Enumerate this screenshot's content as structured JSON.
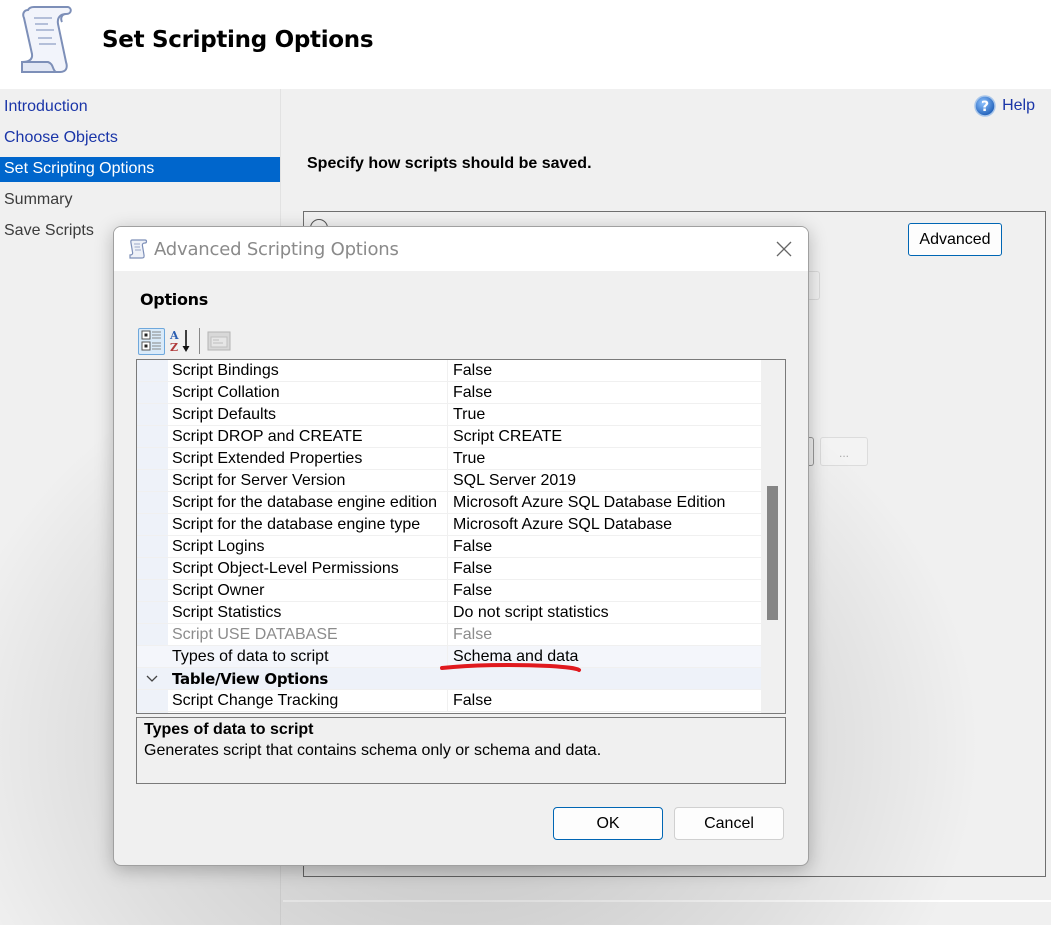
{
  "header": {
    "title": "Set Scripting Options",
    "icon": "scroll-icon"
  },
  "sidebar": {
    "items": [
      {
        "label": "Introduction",
        "state": "link"
      },
      {
        "label": "Choose Objects",
        "state": "link"
      },
      {
        "label": "Set Scripting Options",
        "state": "active"
      },
      {
        "label": "Summary",
        "state": "plain"
      },
      {
        "label": "Save Scripts",
        "state": "plain"
      }
    ]
  },
  "main": {
    "help_label": "Help",
    "help_icon": "help-icon",
    "instruction": "Specify how scripts should be saved.",
    "advanced_label": "Advanced",
    "ellipsis_label": "..."
  },
  "dialog": {
    "title": "Advanced Scripting Options",
    "options_label": "Options",
    "toolbar": {
      "categorized": "categorized-view-icon",
      "alphabetical": "sort-alphabetical-icon",
      "property_pages": "property-pages-icon"
    },
    "rows": [
      {
        "name": "Script Bindings",
        "value": "False"
      },
      {
        "name": "Script Collation",
        "value": "False"
      },
      {
        "name": "Script Defaults",
        "value": "True"
      },
      {
        "name": "Script DROP and CREATE",
        "value": "Script CREATE"
      },
      {
        "name": "Script Extended Properties",
        "value": "True"
      },
      {
        "name": "Script for Server Version",
        "value": "SQL Server 2019"
      },
      {
        "name": "Script for the database engine edition",
        "value": "Microsoft Azure SQL Database Edition"
      },
      {
        "name": "Script for the database engine type",
        "value": "Microsoft Azure SQL Database"
      },
      {
        "name": "Script Logins",
        "value": "False"
      },
      {
        "name": "Script Object-Level Permissions",
        "value": "False"
      },
      {
        "name": "Script Owner",
        "value": "False"
      },
      {
        "name": "Script Statistics",
        "value": "Do not script statistics"
      },
      {
        "name": "Script USE DATABASE",
        "value": "False",
        "disabled": true
      },
      {
        "name": "Types of data to script",
        "value": "Schema and data",
        "selected": true
      },
      {
        "name": "Table/View Options",
        "value": "",
        "category": true
      },
      {
        "name": "Script Change Tracking",
        "value": "False"
      }
    ],
    "description": {
      "title": "Types of data to script",
      "text": "Generates script that contains schema only or schema and data."
    },
    "ok_label": "OK",
    "cancel_label": "Cancel",
    "annotation_color": "#e0191e"
  }
}
